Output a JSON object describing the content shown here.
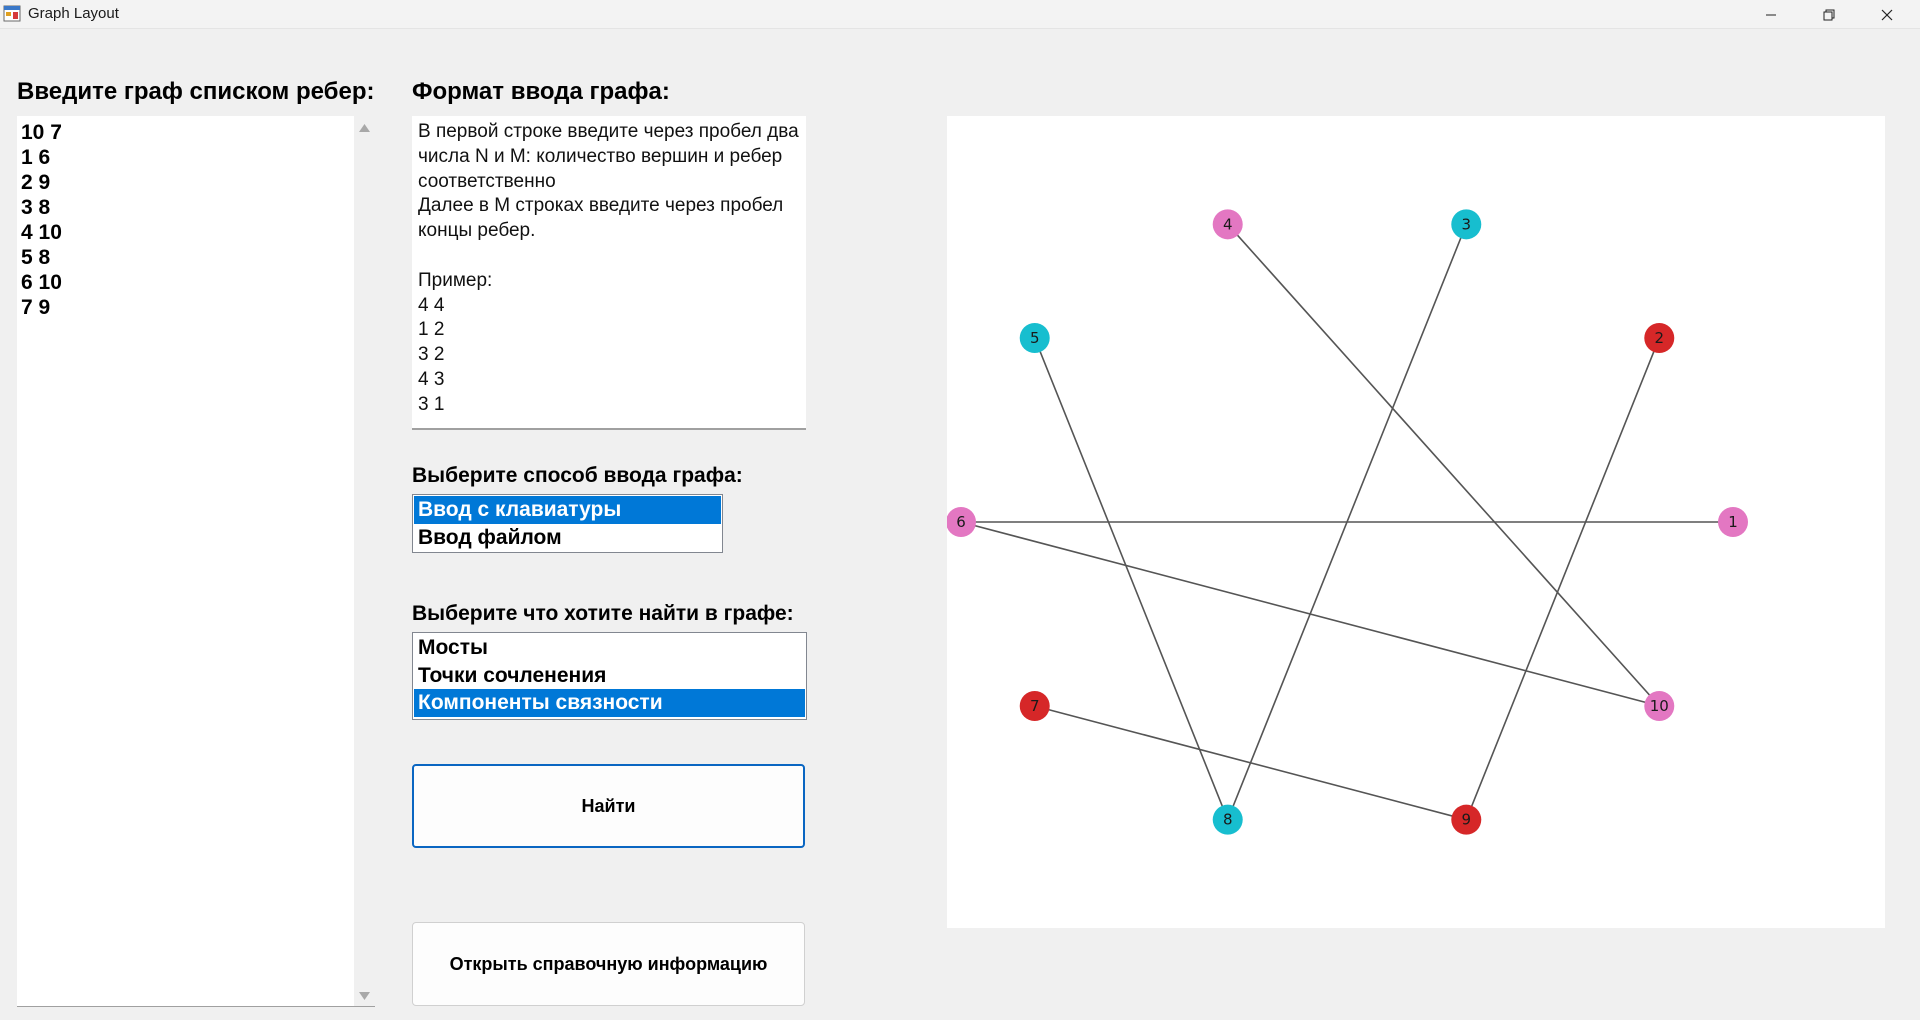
{
  "window": {
    "title": "Graph Layout",
    "controls": [
      "minimize",
      "maximize",
      "close"
    ]
  },
  "edge_input": {
    "label": "Введите граф списком ребер:",
    "value": "10 7\n1 6\n2 9\n3 8\n4 10\n5 8\n6 10\n7 9"
  },
  "format_info": {
    "label": "Формат ввода графа:",
    "text": "В первой строке введите через пробел два числа N и M: количество вершин и ребер соответственно\nДалее в M строках введите через пробел концы ребер.\n\nПример:\n4 4\n1 2\n3 2\n4 3\n3 1"
  },
  "input_method": {
    "label": "Выберите способ ввода графа:",
    "options": [
      "Ввод с клавиатуры",
      "Ввод файлом"
    ],
    "selected": 0
  },
  "search_target": {
    "label": "Выберите что хотите найти в графе:",
    "options": [
      "Мосты",
      "Точки сочленения",
      "Компоненты связности"
    ],
    "selected": 2
  },
  "buttons": {
    "find": "Найти",
    "help": "Открыть справочную информацию"
  },
  "graph": {
    "colors": {
      "pink": "#e377c2",
      "cyan": "#17becf",
      "red": "#d62728",
      "edge": "#555555"
    },
    "nodes": [
      {
        "id": "1",
        "color": "pink"
      },
      {
        "id": "2",
        "color": "red"
      },
      {
        "id": "3",
        "color": "cyan"
      },
      {
        "id": "4",
        "color": "pink"
      },
      {
        "id": "5",
        "color": "cyan"
      },
      {
        "id": "6",
        "color": "pink"
      },
      {
        "id": "7",
        "color": "red"
      },
      {
        "id": "8",
        "color": "cyan"
      },
      {
        "id": "9",
        "color": "red"
      },
      {
        "id": "10",
        "color": "pink"
      }
    ],
    "edges": [
      [
        "10",
        "4"
      ],
      [
        "1",
        "6"
      ],
      [
        "2",
        "9"
      ],
      [
        "3",
        "8"
      ],
      [
        "5",
        "8"
      ],
      [
        "6",
        "10"
      ],
      [
        "7",
        "9"
      ]
    ]
  }
}
